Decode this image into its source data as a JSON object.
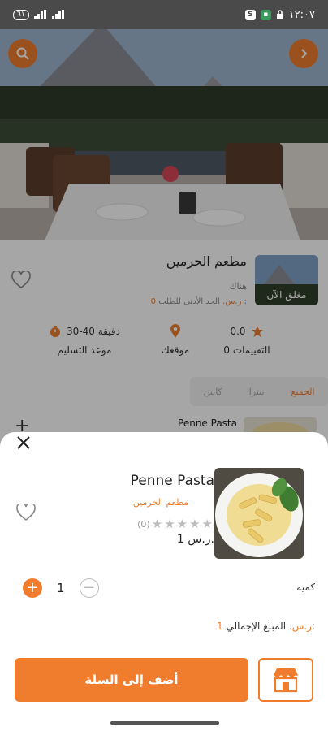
{
  "status_bar": {
    "time": "١٢:٠٧",
    "pill": "٦١",
    "icons": [
      "signal-icon",
      "signal-icon",
      "battery-pill",
      "s-app-icon",
      "messages-icon",
      "lock-icon"
    ]
  },
  "restaurant": {
    "name": "مطعم الحرمين",
    "status": "مغلق الآن",
    "subtitle": "هناك",
    "min_order_label": "الحد الأدنى للطلب :",
    "min_order_value": "0 ر.س.",
    "stats": {
      "rating_value": "0.0",
      "rating_label": "0 التقييمات",
      "location_label": "موقعك",
      "delivery_value": "30-40 دقيقة",
      "delivery_label": "موعد التسليم"
    },
    "tabs": [
      "الجميع",
      "بيتزا",
      "كابتن"
    ],
    "list_item_name": "Penne Pasta"
  },
  "sheet": {
    "product_name": "Penne Pasta",
    "restaurant_name": "مطعم الحرمين",
    "rating_count": "(0)",
    "price": "1 ر.س.",
    "quantity_label": "كمية",
    "quantity_value": "1",
    "total_label": "المبلغ الإجمالي:",
    "total_value": "1 ر.س.",
    "add_to_cart": "أضف إلى السلة"
  },
  "colors": {
    "accent": "#ef7d2d"
  }
}
